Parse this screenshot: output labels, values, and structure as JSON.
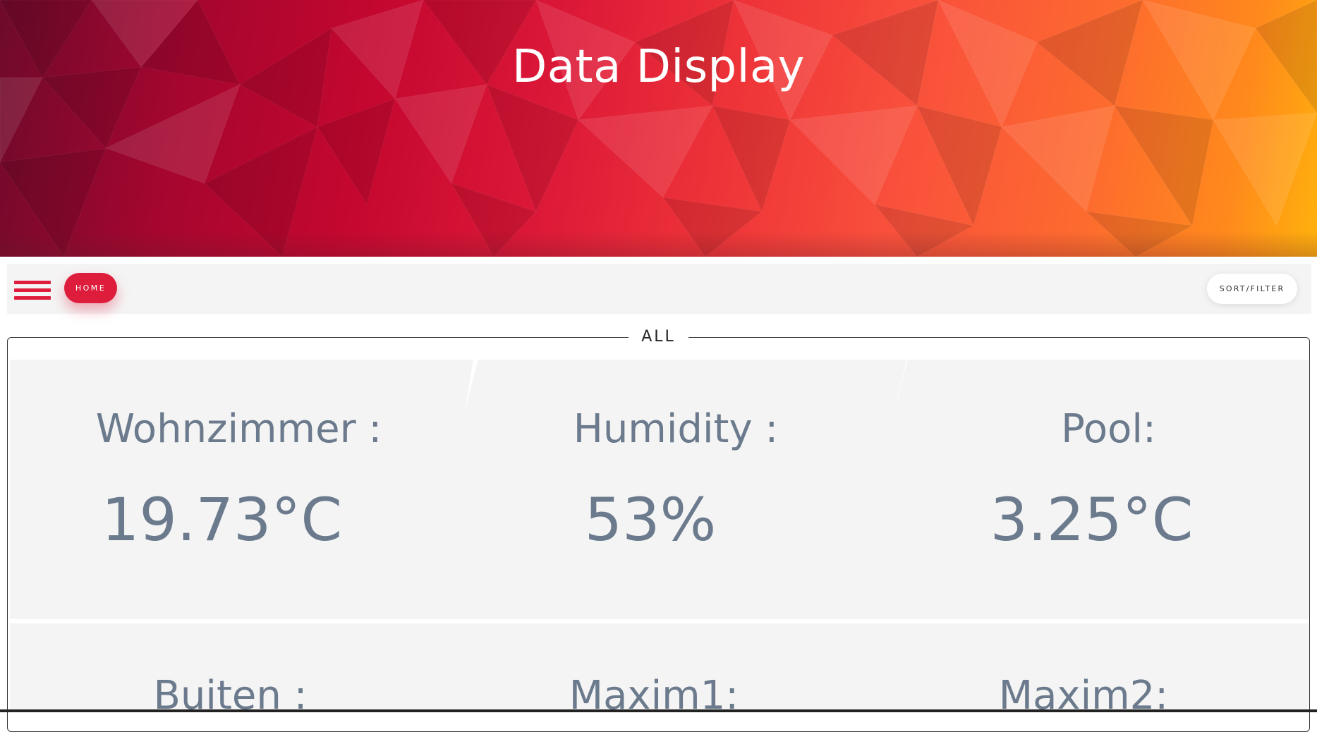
{
  "header": {
    "title": "Data Display"
  },
  "toolbar": {
    "menu_icon": "hamburger-menu-icon",
    "home_label": "HOME",
    "sort_label": "SORT/FILTER"
  },
  "group": {
    "legend": "ALL"
  },
  "cards": [
    {
      "label": "Wohnzimmer :",
      "value": "19.73°C"
    },
    {
      "label": "Humidity :",
      "value": "53%"
    },
    {
      "label": "Pool:",
      "value": "3.25°C"
    },
    {
      "label": "Buiten :",
      "value": ""
    },
    {
      "label": "Maxim1:",
      "value": ""
    },
    {
      "label": "Maxim2:",
      "value": ""
    }
  ],
  "colors": {
    "accent": "#de1d3c",
    "card_text": "#6b7a8c",
    "card_bg": "#f4f4f4",
    "toolbar_bg": "#f4f4f4"
  }
}
